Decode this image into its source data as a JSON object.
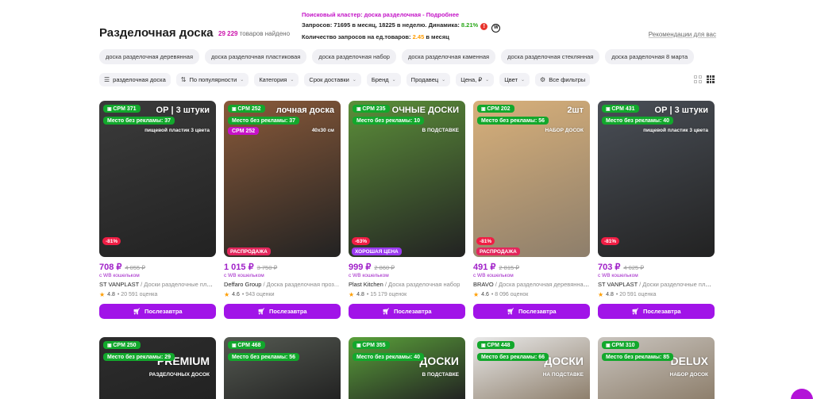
{
  "header": {
    "title": "Разделочная доска",
    "found_count": "29 229",
    "found_suffix": "товаров найдено",
    "recommendations_link": "Рекомендации для вас"
  },
  "cluster": {
    "label": "Поисковый кластер: доска разделочная - Подробнее",
    "requests_text": "Запросов: 71695 в месяц, 18225 в неделю. Динамика:",
    "dynamics": "8.21%",
    "alert_icon": "!",
    "per_item_label": "Количество запросов на ед.товаров:",
    "per_item_value": "2.45",
    "per_item_suffix": "в месяц",
    "wb_logo": "W"
  },
  "chips": [
    "доска разделочная деревянная",
    "доска разделочная пластиковая",
    "доска разделочная набор",
    "доска разделочная каменная",
    "доска разделочная стеклянная",
    "доска разделочная 8 марта"
  ],
  "filters": [
    {
      "label": "разделочная доска",
      "icon": "☰",
      "icon_name": "list-icon",
      "chev": false
    },
    {
      "label": "По популярности",
      "icon": "⇅",
      "icon_name": "sort-icon",
      "chev": true
    },
    {
      "label": "Категория",
      "icon": "",
      "chev": true
    },
    {
      "label": "Срок доставки",
      "icon": "",
      "chev": true
    },
    {
      "label": "Бренд",
      "icon": "",
      "chev": true
    },
    {
      "label": "Продавец",
      "icon": "",
      "chev": true
    },
    {
      "label": "Цена, ₽",
      "icon": "",
      "chev": true
    },
    {
      "label": "Цвет",
      "icon": "",
      "chev": true
    },
    {
      "label": "Все фильтры",
      "icon": "⚙",
      "icon_name": "filter-settings-icon",
      "chev": false
    }
  ],
  "products": [
    {
      "cpm": "CPM 371",
      "place": "Место без рекламы: 37",
      "cpm2": "",
      "bg": "#3b3b3b",
      "photo_title": "ОР | 3 штуки",
      "photo_sub": "пищевой пластик 3 цвета",
      "tag": "",
      "tag_type": "",
      "discount": "-81%",
      "price": "708 ₽",
      "old_price": "4 055 ₽",
      "wallet": "с WB кошельком",
      "brand": "ST VANPLAST",
      "category": "/ Доски разделочные плас...",
      "rating": "4.8",
      "reviews": "• 20 591 оценка",
      "button": "Послезавтра"
    },
    {
      "cpm": "CPM 252",
      "place": "Место без рекламы: 37",
      "cpm2": "CPM 252",
      "bg": "#8a5a3a",
      "photo_title": "лочная доска",
      "photo_sub": "40х30 см",
      "tag": "РАСПРОДАЖА",
      "tag_type": "sale",
      "discount": "",
      "price": "1 015 ₽",
      "old_price": "3 750 ₽",
      "wallet": "с WB кошельком",
      "brand": "Deffaro Group",
      "category": "/ Доска разделочная проз...",
      "rating": "4.6",
      "reviews": "• 943 оценки",
      "button": "Послезавтра"
    },
    {
      "cpm": "CPM 235",
      "place": "Место без рекламы: 10",
      "cpm2": "",
      "bg": "#5c8f3a",
      "photo_title": "ОЧНЫЕ ДОСКИ",
      "photo_sub": "В ПОДСТАВКЕ",
      "tag": "ХОРОШАЯ ЦЕНА",
      "tag_type": "good",
      "discount": "-63%",
      "price": "999 ₽",
      "old_price": "2 860 ₽",
      "wallet": "с WB кошельком",
      "brand": "Plast Kitchen",
      "category": "/ Доска разделочная набор",
      "rating": "4.8",
      "reviews": "• 15 179 оценок",
      "button": "Послезавтра"
    },
    {
      "cpm": "CPM 202",
      "place": "Место без рекламы: 56",
      "cpm2": "",
      "bg": "#d8b07a",
      "photo_title": "2шт",
      "photo_sub": "НАБОР ДОСОК",
      "tag": "РАСПРОДАЖА",
      "tag_type": "sale",
      "discount": "-81%",
      "price": "491 ₽",
      "old_price": "2 815 ₽",
      "wallet": "с WB кошельком",
      "brand": "BRAVO",
      "category": "/ Доска разделочная деревянная н...",
      "rating": "4.6",
      "reviews": "• 8 096 оценок",
      "button": "Послезавтра"
    },
    {
      "cpm": "CPM 431",
      "place": "Место без рекламы: 40",
      "cpm2": "",
      "bg": "#4a4f57",
      "photo_title": "ОР | 3 штуки",
      "photo_sub": "пищевой пластик 3 цвета",
      "tag": "",
      "tag_type": "",
      "discount": "-81%",
      "price": "703 ₽",
      "old_price": "4 025 ₽",
      "wallet": "с WB кошельком",
      "brand": "ST VANPLAST",
      "category": "/ Доски разделочные плас...",
      "rating": "4.8",
      "reviews": "• 20 591 оценка",
      "button": "Послезавтра"
    }
  ],
  "products_row2": [
    {
      "cpm": "CPM 250",
      "place": "Место без рекламы: 29",
      "bg": "#2d2d2d",
      "photo_title": "PREMIUM",
      "photo_sub": "РАЗДЕЛОЧНЫХ ДОСОК"
    },
    {
      "cpm": "CPM 468",
      "place": "Место без рекламы: 56",
      "bg": "#555a52",
      "photo_title": "",
      "photo_sub": ""
    },
    {
      "cpm": "CPM 355",
      "place": "Место без рекламы: 40",
      "bg": "#5aa03a",
      "photo_title": "ДОСКИ",
      "photo_sub": "В ПОДСТАВКЕ"
    },
    {
      "cpm": "CPM 448",
      "place": "Место без рекламы: 66",
      "bg": "#e9e9e9",
      "photo_title": "ДОСКИ",
      "photo_sub": "НА ПОДСТАВКЕ"
    },
    {
      "cpm": "CPM 310",
      "place": "Место без рекламы: 85",
      "bg": "#c9c4be",
      "photo_title": "DELUX",
      "photo_sub": "НАБОР ДОСОК"
    }
  ]
}
